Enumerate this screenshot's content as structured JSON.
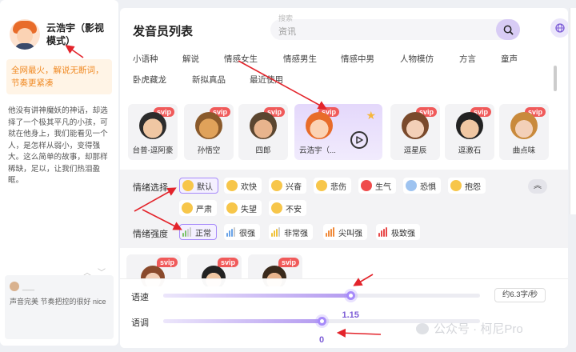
{
  "voice": {
    "name": "云浩宇（影视模式）",
    "promo": "全网最火，解说无断词，节奏更紧凑",
    "intro": "他没有讲神魔妖的神话，却选择了一个极其平凡的小孩，可就在他身上，我们能看见一个人，是怎样从弱小，变得强大。这么简单的故事，却那样稀缺，足以，让我们热泪盈眶。"
  },
  "comment": {
    "user": "___",
    "text": "声音完美 节奏把控的很好 nice"
  },
  "main": {
    "title": "发音员列表",
    "search_hint_top": "搜索",
    "search_placeholder": "资讯"
  },
  "tabs": [
    "小语种",
    "解说",
    "情感女生",
    "情感男生",
    "情感中男",
    "人物模仿",
    "方言",
    "童声",
    "卧虎藏龙",
    "新拟真品",
    "最近使用"
  ],
  "voice_cards": [
    {
      "name": "台普-逗阿豪",
      "badge": "svip"
    },
    {
      "name": "孙悟空",
      "badge": "svip"
    },
    {
      "name": "四郎",
      "badge": "svip"
    },
    {
      "name": "云浩宇（...",
      "badge": "svip"
    },
    {
      "name": "逗星辰",
      "badge": "svip"
    },
    {
      "name": "逗激石",
      "badge": "svip"
    },
    {
      "name": "曲点味",
      "badge": "svip"
    }
  ],
  "voice_cards_row2": [
    {
      "badge": "svip"
    },
    {
      "badge": "svip"
    },
    {
      "badge": "svip"
    }
  ],
  "emotion": {
    "label": "情绪选择",
    "items": [
      "默认",
      "欢快",
      "兴奋",
      "悲伤",
      "生气",
      "恐惧",
      "抱怨",
      "严肃",
      "失望",
      "不安"
    ],
    "selected": "默认"
  },
  "intensity": {
    "label": "情绪强度",
    "items": [
      "正常",
      "很强",
      "非常强",
      "尖叫强",
      "极致强"
    ],
    "selected": "正常"
  },
  "speed": {
    "label": "语速",
    "value": "1.15",
    "fraction": 0.59,
    "rate_text": "约6.3字/秒"
  },
  "pitch": {
    "label": "语调",
    "value": "0",
    "fraction": 0.5
  },
  "watermark": "公众号 · 柯尼Pro",
  "colors": {
    "accent": "#a78bfa",
    "svip": "#f05a5a",
    "promo": "#f08a24",
    "annotation": "#e3242b"
  }
}
